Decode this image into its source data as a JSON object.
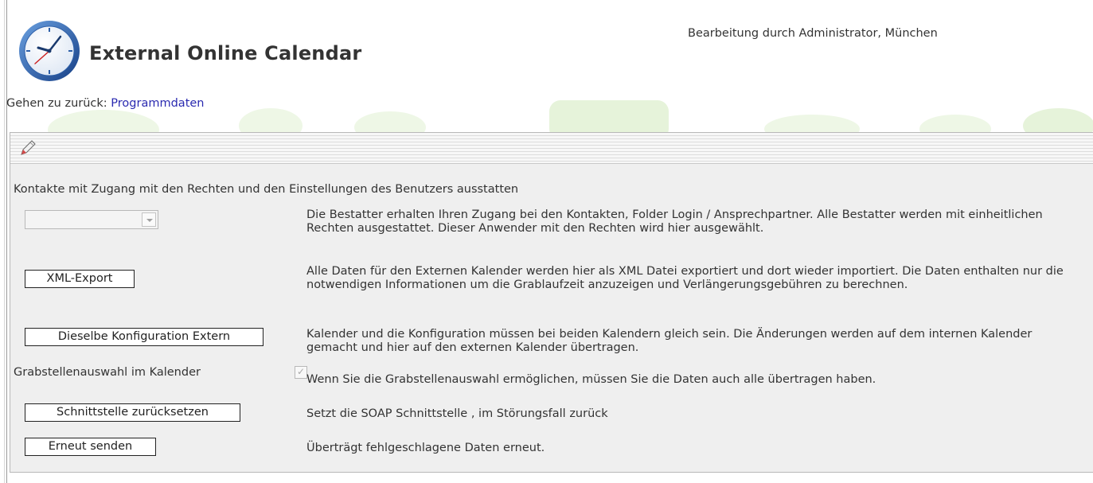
{
  "header": {
    "title": "External Online Calendar",
    "user_info": "Bearbeitung durch Administrator, München",
    "logo_icon": "clock-icon"
  },
  "breadcrumb": {
    "prefix": "Gehen zu zurück: ",
    "link": "Programmdaten"
  },
  "toolbar": {
    "edit_icon": "pencil-icon"
  },
  "section": {
    "title": "Kontakte mit Zugang mit den Rechten und den Einstellungen des Benutzers ausstatten"
  },
  "rows": {
    "user_select": {
      "value": "",
      "description": "Die Bestatter erhalten Ihren Zugang bei den Kontakten, Folder Login / Ansprechpartner. Alle Bestatter werden mit einheitlichen Rechten ausgestattet. Dieser Anwender mit den Rechten wird hier ausgewählt."
    },
    "xml_export": {
      "label": "XML-Export",
      "description": "Alle Daten für den Externen Kalender werden hier als XML Datei exportiert und dort wieder importiert. Die Daten enthalten nur die notwendigen Informationen um die Grablaufzeit anzuzeigen und Verlängerungsgebühren zu berechnen."
    },
    "same_config": {
      "label": "Dieselbe Konfiguration Extern",
      "description": "Kalender und die Konfiguration müssen bei beiden Kalendern gleich sein. Die Änderungen werden auf dem internen Kalender gemacht und hier auf den externen Kalender übertragen."
    },
    "grave_selection": {
      "label": "Grabstellenauswahl im Kalender",
      "checked": true,
      "description": "Wenn Sie die Grabstellenauswahl ermöglichen, müssen Sie die Daten auch alle übertragen haben."
    },
    "reset_interface": {
      "label": "Schnittstelle zurücksetzen",
      "description": "Setzt die SOAP Schnittstelle , im Störungsfall zurück"
    },
    "resend": {
      "label": "Erneut senden",
      "description": "Überträgt fehlgeschlagene Daten erneut."
    }
  },
  "colors": {
    "link": "#2a2ab0",
    "panel_bg": "#efefef",
    "logo_blue": "#1e5aa8"
  }
}
